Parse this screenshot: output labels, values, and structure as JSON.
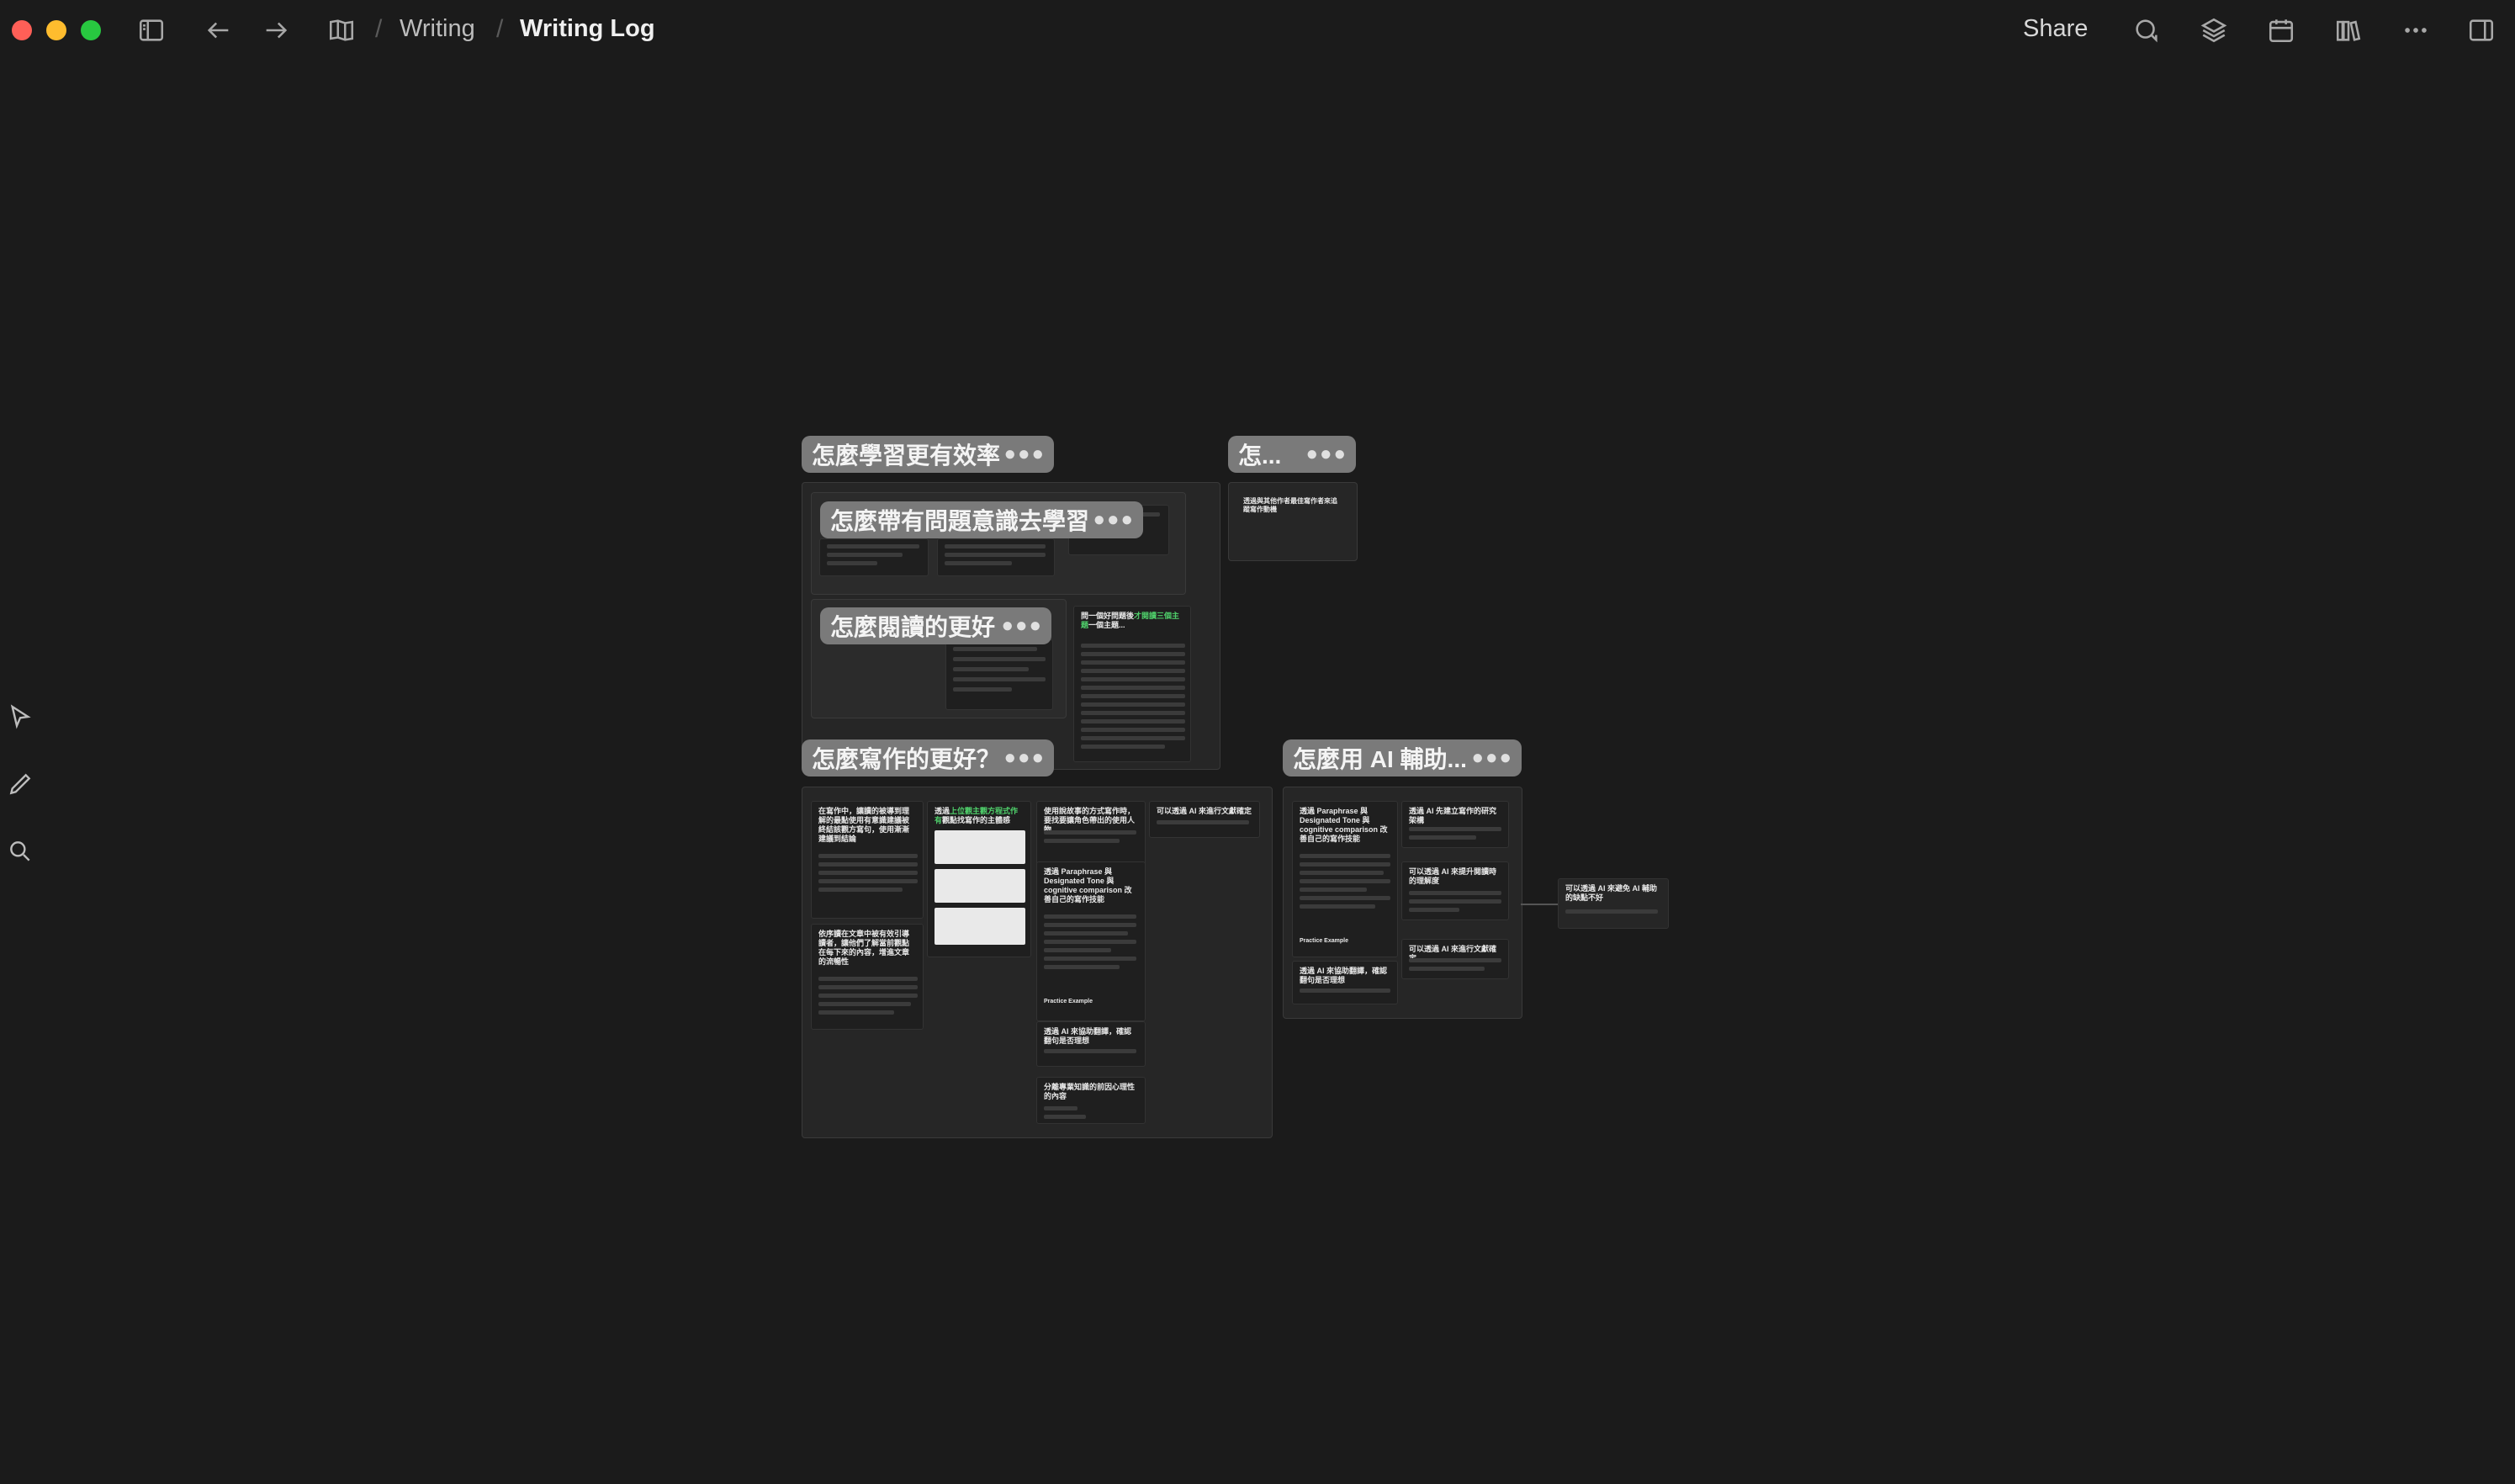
{
  "window": {
    "traffic_lights": [
      "#ff5f57",
      "#febc2e",
      "#28c840"
    ]
  },
  "toolbar": {
    "sidebar_toggle_icon": "sidebar-left-icon",
    "back_icon": "arrow-left-icon",
    "forward_icon": "arrow-right-icon",
    "book_icon": "open-book-icon",
    "breadcrumb": [
      "Writing",
      "Writing Log"
    ],
    "share_label": "Share",
    "right_icons": [
      "chat-bubble-icon",
      "layers-icon",
      "calendar-icon",
      "library-icon",
      "more-icon",
      "sidebar-right-icon"
    ]
  },
  "left_tools": [
    "cursor-icon",
    "pen-icon",
    "search-icon"
  ],
  "canvas": {
    "groups": [
      {
        "title": "怎麼學習更有效率",
        "subgroups": [
          {
            "title": "怎麼帶有問題意識去學習"
          },
          {
            "title": "怎麼閱讀的更好"
          }
        ],
        "cards": [
          {
            "title": "問一個好問題後",
            "highlight": "才閱讀三個主題",
            "tail": "一個主題...",
            "lines": 24
          }
        ]
      },
      {
        "title": "怎...",
        "cards": [
          {
            "title": "透過與其他作者最佳寫作者來追蹤寫作動機"
          }
        ]
      },
      {
        "title": "怎麼寫作的更好？",
        "cards": [
          {
            "title": "在寫作中，讓讀的被導到理解的最點使用有意識建議被終結該觀方寫句，使用漸漸建議到結論"
          },
          {
            "title": "依序讀在文章中被有效引導讀者，讓他們了解當前觀點在每下來的內容，增進文章的流暢性"
          },
          {
            "title": "透過",
            "highlight": "上位觀主觀方程式作有",
            "tail": "觀點找寫作的主體感"
          },
          {
            "title": "使用說故事的方式寫作時，要找要讓角色帶出的使用人物"
          },
          {
            "title": "透過 Paraphrase 與 Designated Tone 與 cognitive comparison 改善自己的寫作技能"
          },
          {
            "title": "Practice Example"
          },
          {
            "title": "透過 AI 來協助翻譯，確認翻句是否理想"
          },
          {
            "title": "分離專業知識的前因心理性的內容"
          },
          {
            "title": "可以透過 AI 來進行文獻確定"
          }
        ]
      },
      {
        "title": "怎麼用 AI 輔助...",
        "cards": [
          {
            "title": "透過 Paraphrase 與 Designated Tone 與 cognitive comparison 改善自己的寫作技能"
          },
          {
            "title": "透過 AI 先建立寫作的研究架構"
          },
          {
            "title": "可以透過 AI 來提升閱讀時的理解度"
          },
          {
            "title": "Practice Example"
          },
          {
            "title": "透過 AI 來協助翻譯，確認翻句是否理想"
          },
          {
            "title": "可以透過 AI 來進行文獻確定"
          },
          {
            "title": "可以透過 AI 來避免 AI 輔助的缺點不好"
          }
        ]
      }
    ]
  }
}
